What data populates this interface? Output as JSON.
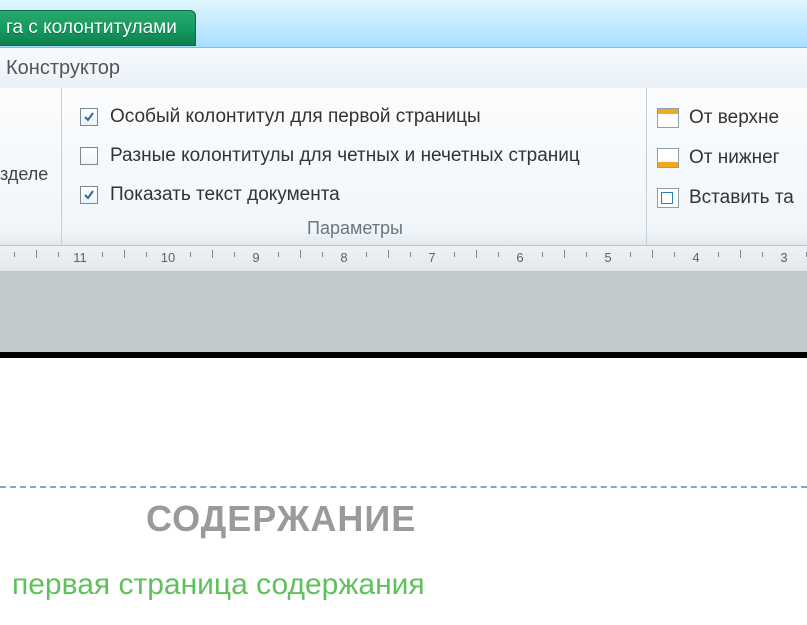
{
  "title_tab": "га с колонтитулами",
  "tabs": {
    "active": "Конструктор"
  },
  "options_group": {
    "label": "Параметры",
    "items": [
      {
        "label": "Особый колонтитул для первой страницы",
        "checked": true
      },
      {
        "label": "Разные колонтитулы для четных и нечетных страниц",
        "checked": false
      },
      {
        "label": "Показать текст документа",
        "checked": true
      }
    ]
  },
  "left_partial": "зделе",
  "position_group": {
    "items": [
      {
        "label": "От верхне"
      },
      {
        "label": "От нижнег"
      },
      {
        "label": "Вставить та"
      }
    ]
  },
  "ruler_numbers": [
    11,
    10,
    9,
    8,
    7,
    6,
    5,
    4,
    3
  ],
  "document": {
    "heading": "СОДЕРЖАНИЕ",
    "subline": "первая страница содержания"
  }
}
